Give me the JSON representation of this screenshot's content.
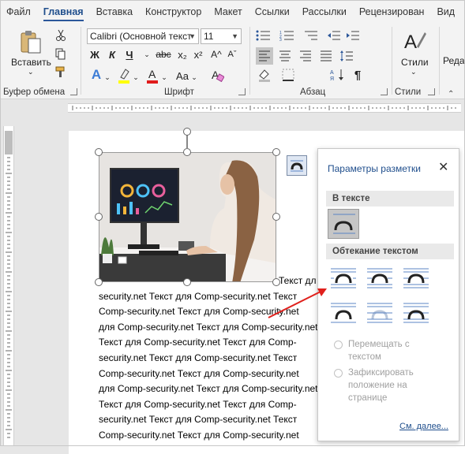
{
  "tabs": [
    "Файл",
    "Главная",
    "Вставка",
    "Конструктор",
    "Макет",
    "Ссылки",
    "Рассылки",
    "Рецензирован",
    "Вид"
  ],
  "ribbon": {
    "clipboard": {
      "paste_label": "Вставить",
      "group_label": "Буфер обмена"
    },
    "font": {
      "font_name": "Calibri (Основной текст",
      "font_size": "11",
      "group_label": "Шрифт",
      "bold": "Ж",
      "italic": "К",
      "underline": "Ч",
      "strike": "abc",
      "sub": "x₂",
      "sup": "x²",
      "grow": "A^",
      "shrink": "Aˇ",
      "case": "Aa",
      "clear": "A"
    },
    "paragraph": {
      "group_label": "Абзац",
      "pilcrow": "¶"
    },
    "styles": {
      "label": "Стили",
      "group_label": "Стили"
    },
    "editing": {
      "label": "Реда"
    }
  },
  "document": {
    "lines": [
      "Текст дл",
      "security.net Текст для Comp-security.net Текст",
      "Comp-security.net Текст для Comp-security.net",
      "для Comp-security.net Текст для Comp-security.net",
      "Текст для Comp-security.net Текст для Comp-",
      "security.net Текст для Comp-security.net Текст",
      "Comp-security.net Текст для Comp-security.net",
      "для Comp-security.net Текст для Comp-security.net",
      "Текст для Comp-security.net Текст для Comp-",
      "security.net Текст для Comp-security.net Текст",
      "Comp-security.net Текст для Comp-security.net"
    ]
  },
  "layout_pane": {
    "title": "Параметры разметки",
    "in_text": "В тексте",
    "wrap": "Обтекание текстом",
    "move_with_text": [
      "Перемещать с",
      "текстом"
    ],
    "fix_position": [
      "Зафиксировать",
      "положение на",
      "странице"
    ],
    "see_more": "См. далее...",
    "info": "i"
  },
  "colors": {
    "accent": "#2b579a",
    "highlight": "#ffff00",
    "font_color": "#e01b1b",
    "arrow": "#e0201c"
  }
}
